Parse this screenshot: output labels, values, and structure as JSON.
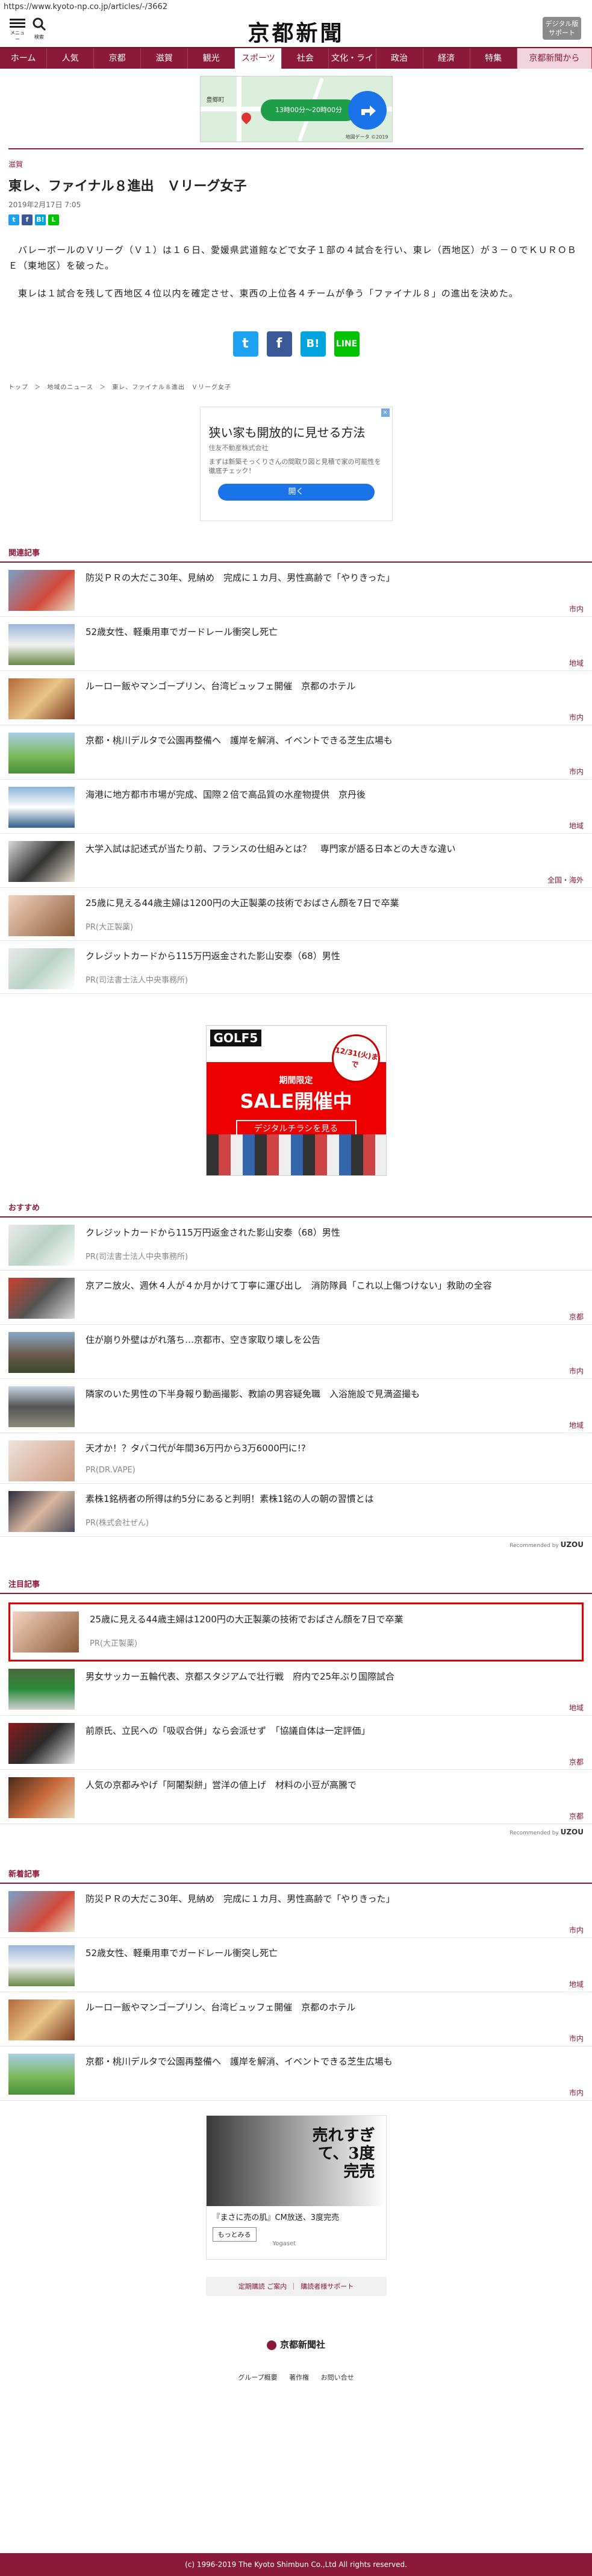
{
  "url": "https://www.kyoto-np.co.jp/articles/-/3662",
  "header": {
    "menu_label": "メニュー",
    "search_label": "検索",
    "logo": "京都新聞",
    "digital_btn": "デジタル版\nサポート"
  },
  "nav": [
    "ホーム",
    "人気",
    "京都",
    "滋賀",
    "観光",
    "スポーツ",
    "社会",
    "文化・ライフ",
    "政治",
    "経済",
    "特集",
    "京都新聞から"
  ],
  "map_ad": {
    "cta": "13時00分～20時00分",
    "place": "豊郷町",
    "credit": "地図データ ©2019"
  },
  "article": {
    "category": "滋賀",
    "title": "東レ、ファイナル８進出　Ｖリーグ女子",
    "date": "2019年2月17日 7:05",
    "paragraphs": [
      "　バレーボールのＶリーグ（Ｖ１）は１６日、愛媛県武道館などで女子１部の４試合を行い、東レ（西地区）が３－０でＫＵＲＯＢＥ（東地区）を破った。",
      "　東レは１試合を残して西地区４位以内を確定させ、東西の上位各４チームが争う「ファイナル８」の進出を決めた。"
    ]
  },
  "breadcrumb": [
    "トップ",
    "＞",
    "地域のニュース",
    "＞",
    "東レ、ファイナル８進出　Ｖリーグ女子"
  ],
  "ad1": {
    "title": "狭い家も開放的に見せる方法",
    "sponsor": "住友不動産株式会社",
    "desc": "まずは新築そっくりさんの間取り図と見積で家の可能性を徹底チェック！",
    "button": "開く"
  },
  "related": {
    "heading": "関連記事",
    "items": [
      {
        "title": "防災ＰＲの大だこ30年、見納め　完成に１カ月、男性高齢で「やりきった」",
        "tag": "市内"
      },
      {
        "title": "52歳女性、軽乗用車でガードレール衝突し死亡",
        "tag": "地域"
      },
      {
        "title": "ルーロー飯やマンゴープリン、台湾ビュッフェ開催　京都のホテル",
        "tag": "市内"
      },
      {
        "title": "京都・桃川デルタで公園再整備へ　護岸を解消、イベントできる芝生広場も",
        "tag": "市内"
      },
      {
        "title": "海港に地方都市市場が完成、国際２倍で高品質の水産物提供　京丹後",
        "tag": "地域"
      },
      {
        "title": "大学入試は記述式が当たり前、フランスの仕組みとは？　専門家が語る日本との大きな違い",
        "tag": "全国・海外"
      },
      {
        "title": "25歳に見える44歳主婦は1200円の大正製薬の技術でおばさん顔を7日で卒業",
        "tag": "",
        "pr": "PR(大正製薬)"
      },
      {
        "title": "クレジットカードから115万円返金された影山安泰（68）男性",
        "tag": "",
        "pr": "PR(司法書士法人中央事務所)"
      }
    ]
  },
  "golf_ad": {
    "brand": "GOLF5",
    "date": "12/31(火)まで",
    "period": "期間限定",
    "sale": "SALE開催中",
    "cta": "デジタルチラシを見る"
  },
  "recommend": {
    "heading": "おすすめ",
    "items": [
      {
        "title": "クレジットカードから115万円返金された影山安泰（68）男性",
        "tag": "",
        "pr": "PR(司法書士法人中央事務所)"
      },
      {
        "title": "京アニ放火、週休４人が４か月かけて丁寧に運び出し　消防隊員「これ以上傷つけない」救助の全容",
        "tag": "京都"
      },
      {
        "title": "住が崩り外壁はがれ落ち…京都市、空き家取り壊しを公告",
        "tag": "市内"
      },
      {
        "title": "隣家のいた男性の下半身報り動画撮影、教諭の男容疑免職　入浴施設で見満盗撮も",
        "tag": "地域"
      },
      {
        "title": "天才か！？タバコ代が年間36万円から3万6000円に!?",
        "tag": "",
        "pr": "PR(DR.VAPE)"
      },
      {
        "title": "素株1銘柄者の所得は約5分にあると判明！素株1銘の人の朝の習慣とは",
        "tag": "",
        "pr": "PR(株式会社ぜん)"
      }
    ],
    "recommended_by": "Recommended by",
    "recommended_brand": "UZOU"
  },
  "notable": {
    "heading": "注目記事",
    "highlighted": {
      "title": "25歳に見える44歳主婦は1200円の大正製薬の技術でおばさん顔を7日で卒業",
      "pr": "PR(大正製薬)"
    },
    "items": [
      {
        "title": "男女サッカー五輪代表、京都スタジアムで壮行戦　府内で25年ぶり国際試合",
        "tag": "地域"
      },
      {
        "title": "前原氏、立民への「吸収合併」なら会派せず　「協議自体は一定評価」",
        "tag": "京都"
      },
      {
        "title": "人気の京都みやげ「阿闍梨餅」営洋の値上げ　材料の小豆が高騰で",
        "tag": "京都"
      }
    ],
    "recommended_by": "Recommended by",
    "recommended_brand": "UZOU"
  },
  "latest": {
    "heading": "新着記事",
    "items": [
      {
        "title": "防災ＰＲの大だこ30年、見納め　完成に１カ月、男性高齢で「やりきった」",
        "tag": "市内"
      },
      {
        "title": "52歳女性、軽乗用車でガードレール衝突し死亡",
        "tag": "地域"
      },
      {
        "title": "ルーロー飯やマンゴープリン、台湾ビュッフェ開催　京都のホテル",
        "tag": "市内"
      },
      {
        "title": "京都・桃川デルタで公園再整備へ　護岸を解消、イベントできる芝生広場も",
        "tag": "市内"
      }
    ]
  },
  "cosme_ad": {
    "headline": "売れすぎて、3度完売",
    "caption": "『まさに売の肌』CM放送、3度完売",
    "more": "もっとみる",
    "brand": "Yogaset"
  },
  "sub_links": [
    "定期購読 ご案内",
    "｜",
    "購読者様サポート"
  ],
  "footer": {
    "logo": "京都新聞社",
    "links": [
      "グループ概要",
      "著作権",
      "お問い合せ"
    ],
    "copyright": "(c) 1996-2019 The Kyoto Shimbun Co.,Ltd All rights reserved."
  }
}
